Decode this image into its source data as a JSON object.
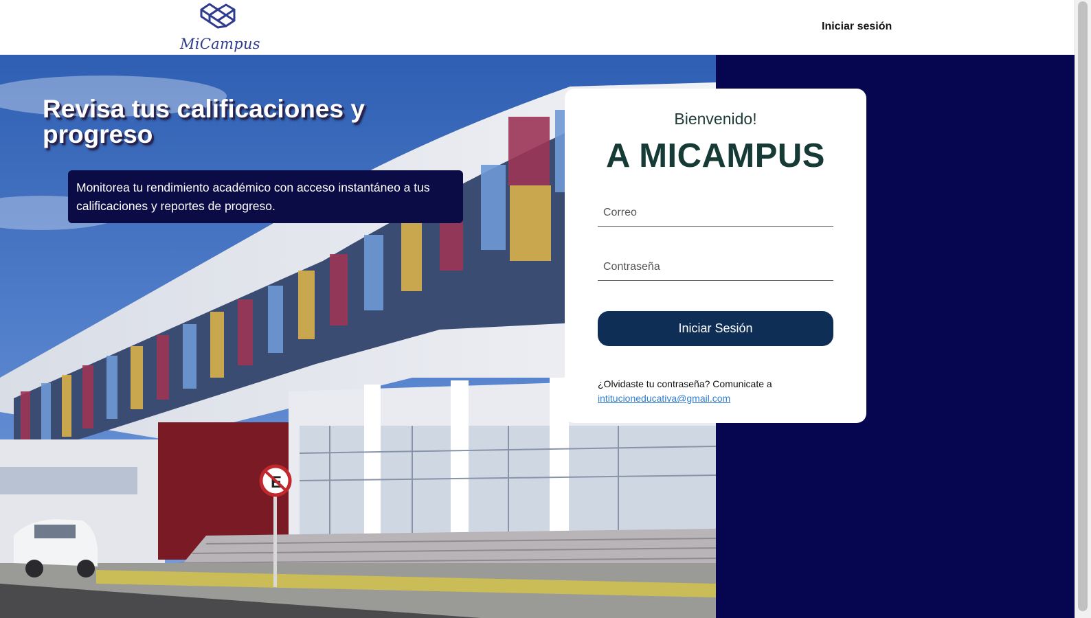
{
  "header": {
    "logo_text": "MiCampus",
    "login_link": "Iniciar sesión"
  },
  "hero": {
    "title": "Revisa tus calificaciones y progreso",
    "description": "Monitorea tu rendimiento académico con acceso instantáneo a tus calificaciones y reportes de progreso."
  },
  "login": {
    "welcome": "Bienvenido!",
    "title": "A MICAMPUS",
    "email_placeholder": "Correo",
    "password_placeholder": "Contraseña",
    "submit_label": "Iniciar Sesión",
    "forgot_text": "¿Olvidaste tu contraseña? Comunicate a",
    "contact_email": "intitucioneducativa@gmail.com"
  },
  "colors": {
    "side_panel": "#05064f",
    "button": "#0e2e56",
    "brand": "#2f3b8f",
    "title": "#163a35"
  }
}
